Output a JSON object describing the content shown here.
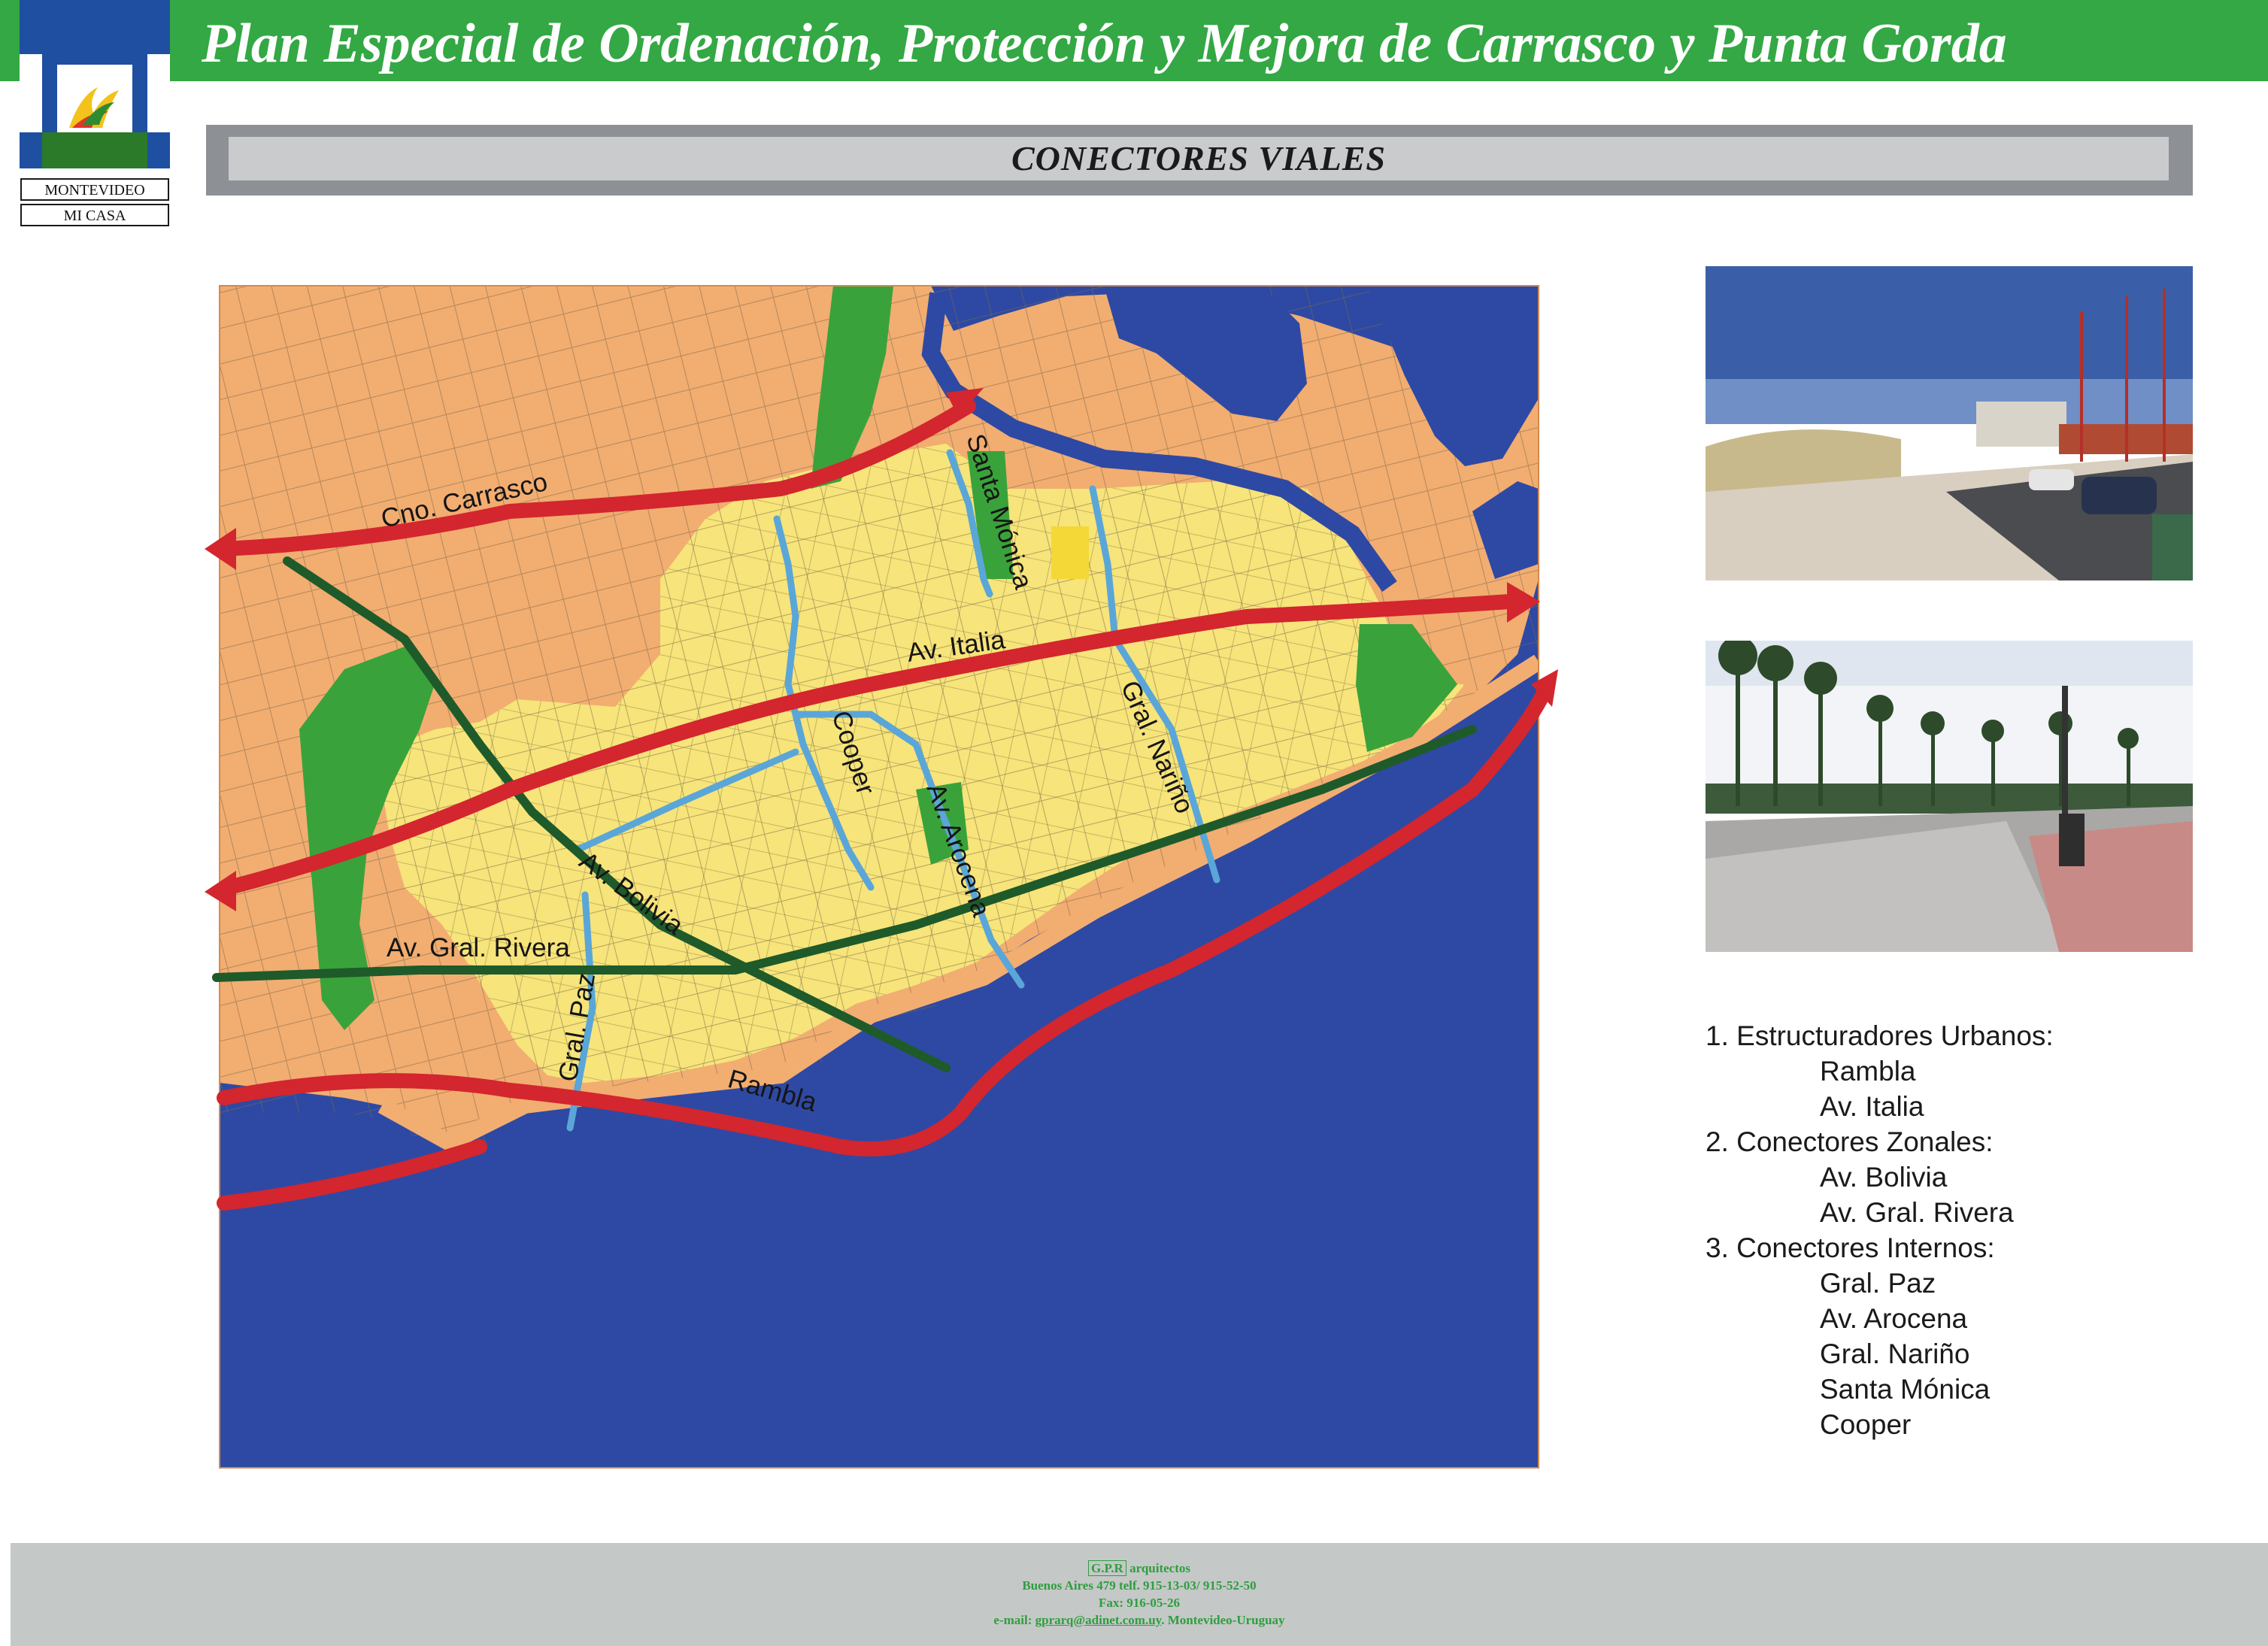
{
  "header": {
    "title": "Plan Especial de Ordenación, Protección y Mejora de Carrasco y Punta Gorda",
    "logo": {
      "line1": "MONTEVIDEO",
      "line2": "MI CASA"
    }
  },
  "section": {
    "title": "CONECTORES VIALES"
  },
  "map": {
    "street_labels": {
      "cno_carrasco": "Cno. Carrasco",
      "santa_monica": "Santa Mónica",
      "av_italia": "Av. Italia",
      "gral_narino": "Gral. Nariño",
      "cooper": "Cooper",
      "av_arocena": "Av. Arocena",
      "av_bolivia": "Av. Bolivia",
      "av_gral_rivera": "Av. Gral. Rivera",
      "gral_paz": "Gral. Paz",
      "rambla": "Rambla"
    },
    "colors": {
      "sea": "#2e49a3",
      "land": "#f2ad71",
      "urban": "#f7e47a",
      "park": "#3aa23a",
      "estructuradores": "#d3262e",
      "conectores_zonales": "#1f5a2a",
      "conectores_internos": "#5aa6d8"
    }
  },
  "legend": {
    "groups": [
      {
        "title": "1. Estructuradores Urbanos:",
        "items": [
          "Rambla",
          "Av. Italia"
        ]
      },
      {
        "title": "2. Conectores Zonales:",
        "items": [
          "Av. Bolivia",
          "Av. Gral. Rivera"
        ]
      },
      {
        "title": "3. Conectores Internos:",
        "items": [
          "Gral. Paz",
          "Av. Arocena",
          "Gral. Nariño",
          "Santa Mónica",
          "Cooper"
        ]
      }
    ]
  },
  "footer": {
    "firm_abbr": "G.P.R",
    "firm_suffix": "arquitectos",
    "address": "Buenos Aires 479  telf. 915-13-03/ 915-52-50",
    "fax": "Fax: 916-05-26",
    "email_prefix": "e-mail: ",
    "email": "gprarq@adinet.com.uy",
    "email_suffix": ". Montevideo-Uruguay"
  }
}
